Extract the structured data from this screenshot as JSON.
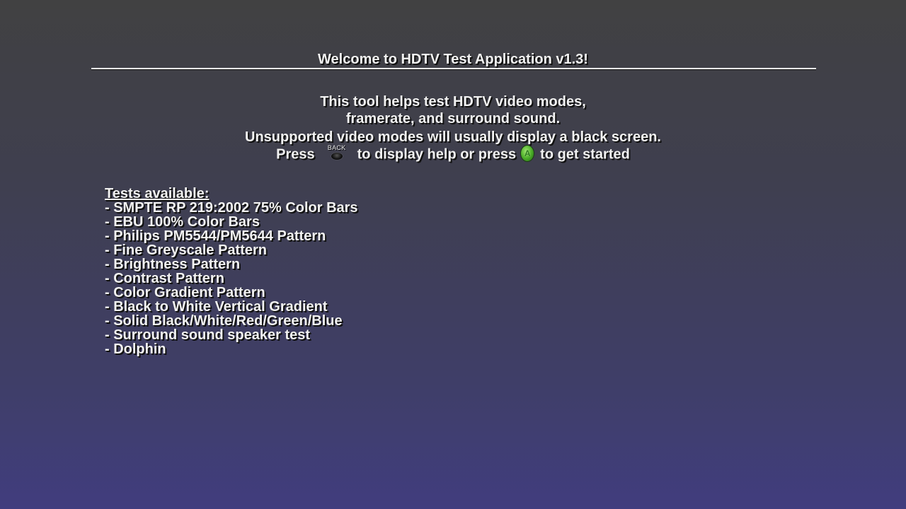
{
  "header": {
    "title": "Welcome to HDTV Test Application v1.3!"
  },
  "intro": {
    "line1": "This tool helps test HDTV video modes,",
    "line2": "framerate, and surround sound.",
    "line3": "Unsupported video modes will usually display a black screen.",
    "press_prefix": "Press",
    "back_button_label": "BACK",
    "back_action": "to display help or press",
    "a_button_label": "A",
    "a_action": "to get started"
  },
  "tests": {
    "heading": "Tests available:",
    "items": [
      "- SMPTE RP 219:2002 75% Color Bars",
      "- EBU 100% Color Bars",
      "- Philips PM5544/PM5644 Pattern",
      "- Fine Greyscale Pattern",
      "- Brightness Pattern",
      "- Contrast Pattern",
      "- Color Gradient Pattern",
      "- Black to White Vertical Gradient",
      "- Solid Black/White/Red/Green/Blue",
      "- Surround sound speaker test",
      "- Dolphin"
    ]
  },
  "colors": {
    "background_top": "#414142",
    "background_bottom": "#413d7e",
    "text": "#f2f2f2",
    "a_button": "#4eb02a"
  }
}
